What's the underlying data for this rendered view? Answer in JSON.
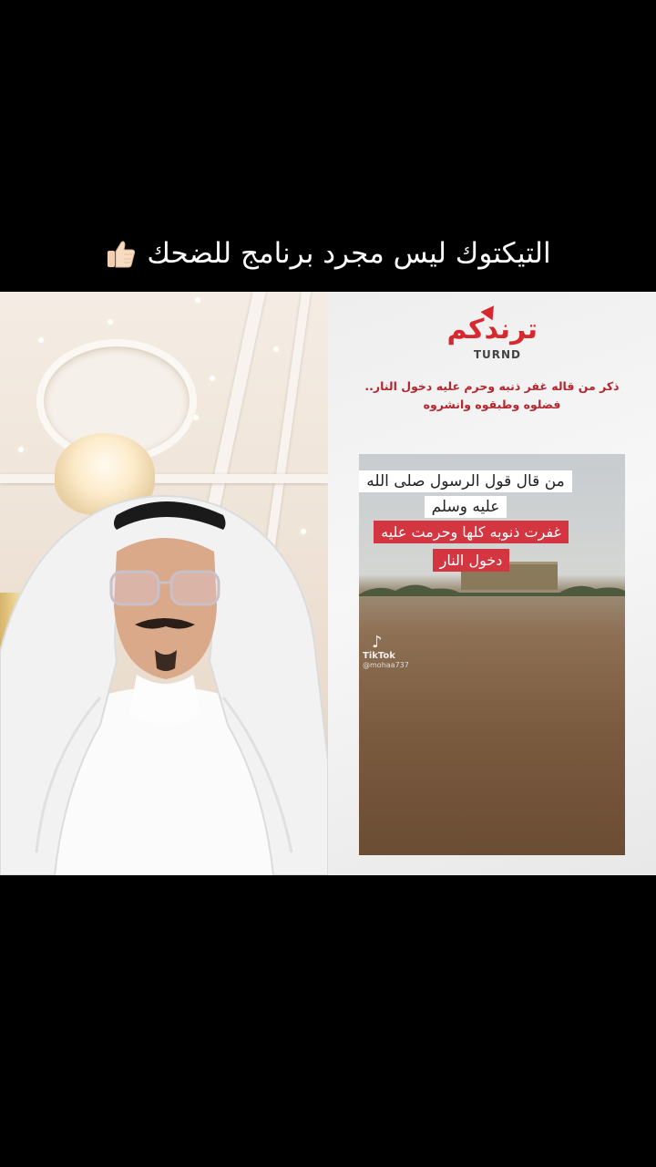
{
  "caption": {
    "text": "التيكتوك ليس مجرد برنامج للضحك",
    "emoji": "thumbs-up-icon"
  },
  "left_pane": {
    "scene": "person-in-hall"
  },
  "right_pane": {
    "brand": {
      "arabic": "ترندكم",
      "english": "TURND"
    },
    "headline": [
      "ذكر من قاله غفر ذنبه وحرم عليه دخول النار..",
      "فضلوه وطبقوه وانشروه"
    ],
    "video": {
      "question": "من قال قول الرسول صلى الله عليه وسلم",
      "answer": "غفرت ذنوبه كلها وحرمت عليه دخول النار",
      "tiktok_label": "TikTok",
      "tiktok_user": "@mohaa737"
    }
  },
  "colors": {
    "accent_red": "#d33640",
    "brand_red": "#d7282f",
    "background": "#000000"
  }
}
